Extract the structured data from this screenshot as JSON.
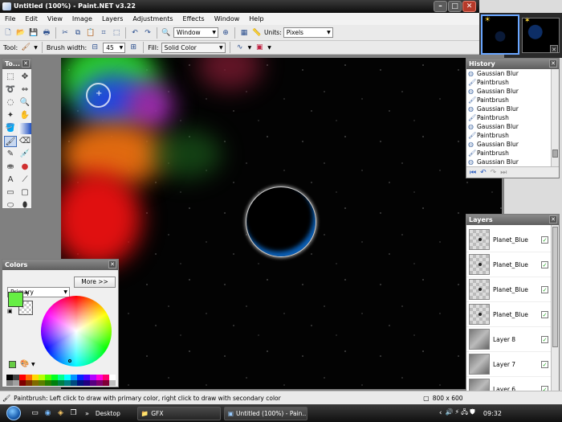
{
  "window": {
    "title": "Untitled (100%) - Paint.NET v3.22",
    "minimize": "–",
    "maximize": "□",
    "close": "✕"
  },
  "menus": [
    "File",
    "Edit",
    "View",
    "Image",
    "Layers",
    "Adjustments",
    "Effects",
    "Window",
    "Help"
  ],
  "toolbar": {
    "window_combo": "Window",
    "units_label": "Units:",
    "units_value": "Pixels"
  },
  "toolbar2": {
    "tool_label": "Tool:",
    "brush_width_label": "Brush width:",
    "brush_width_value": "45",
    "fill_label": "Fill:",
    "fill_value": "Solid Color"
  },
  "tools_panel": {
    "title": "To..."
  },
  "history": {
    "title": "History",
    "items": [
      {
        "label": "Gaussian Blur",
        "icon": "blur-icon"
      },
      {
        "label": "Paintbrush",
        "icon": "paintbrush-icon"
      },
      {
        "label": "Gaussian Blur",
        "icon": "blur-icon"
      },
      {
        "label": "Paintbrush",
        "icon": "paintbrush-icon"
      },
      {
        "label": "Gaussian Blur",
        "icon": "blur-icon"
      },
      {
        "label": "Paintbrush",
        "icon": "paintbrush-icon"
      },
      {
        "label": "Gaussian Blur",
        "icon": "blur-icon"
      },
      {
        "label": "Paintbrush",
        "icon": "paintbrush-icon"
      },
      {
        "label": "Gaussian Blur",
        "icon": "blur-icon"
      },
      {
        "label": "Paintbrush",
        "icon": "paintbrush-icon"
      },
      {
        "label": "Gaussian Blur",
        "icon": "blur-icon"
      }
    ]
  },
  "layers": {
    "title": "Layers",
    "items": [
      {
        "name": "Planet_Blue",
        "visible": true,
        "thumb": "dotted"
      },
      {
        "name": "Planet_Blue",
        "visible": true,
        "thumb": "dotted"
      },
      {
        "name": "Planet_Blue",
        "visible": true,
        "thumb": "dotted"
      },
      {
        "name": "Planet_Blue",
        "visible": true,
        "thumb": "dotted"
      },
      {
        "name": "Layer 8",
        "visible": true,
        "thumb": "noise"
      },
      {
        "name": "Layer 7",
        "visible": true,
        "thumb": "noise"
      },
      {
        "name": "Layer 6",
        "visible": true,
        "thumb": "noise"
      }
    ]
  },
  "colors": {
    "title": "Colors",
    "mode": "Primary",
    "more_button": "More >>",
    "primary_color": "#66ee44",
    "secondary_color": "#ffffff"
  },
  "palette": [
    "#000000",
    "#404040",
    "#ff0000",
    "#ff6a00",
    "#ffd800",
    "#b6ff00",
    "#4cff00",
    "#00ff21",
    "#00ff90",
    "#00ffff",
    "#0094ff",
    "#0026ff",
    "#4800ff",
    "#b200ff",
    "#ff00dc",
    "#ff006e",
    "#ffffff",
    "#808080",
    "#a0a0a0",
    "#7f0000",
    "#7f3300",
    "#7f6a00",
    "#5b7f00",
    "#267f00",
    "#007f0e",
    "#007f46",
    "#007f7f",
    "#004a7f",
    "#00137f",
    "#21007f",
    "#57007f",
    "#7f006e",
    "#7f0037",
    "#c0c0c0"
  ],
  "status": {
    "message": "Paintbrush: Left click to draw with primary color, right click to draw with secondary color",
    "size": "800 x 600"
  },
  "taskbar": {
    "items": [
      {
        "label": "Desktop"
      },
      {
        "label": "GFX"
      },
      {
        "label": "Untitled (100%) - Pain..."
      }
    ],
    "clock": "09:32"
  }
}
